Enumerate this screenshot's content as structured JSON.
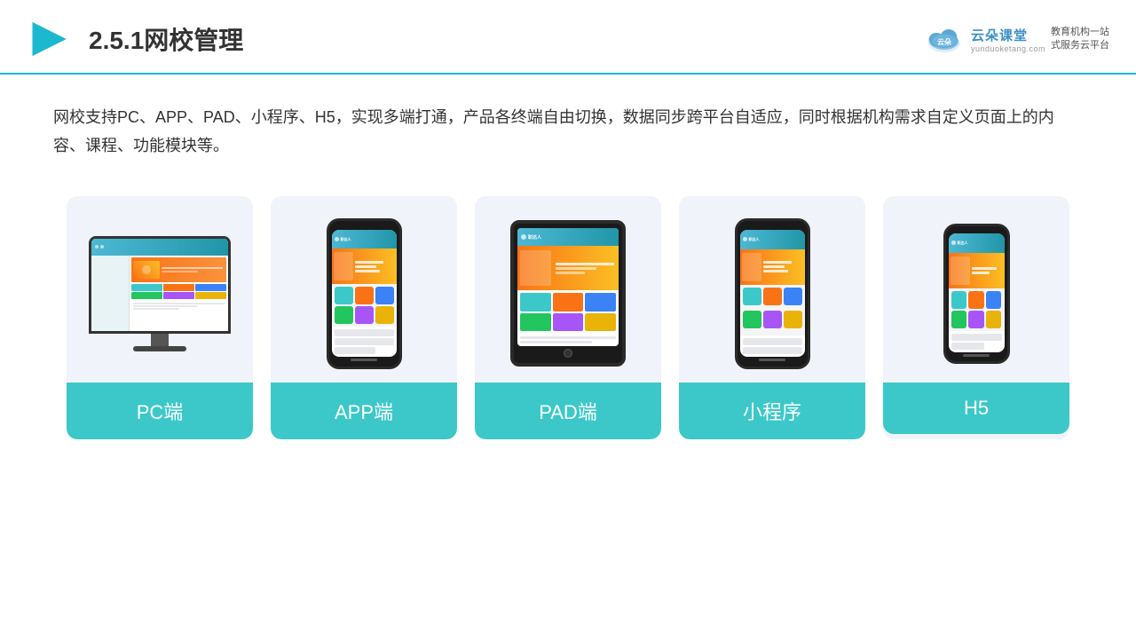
{
  "header": {
    "title": "2.5.1网校管理",
    "brand": {
      "name": "云朵课堂",
      "url": "yunduoketang.com",
      "slogan": "教育机构一站\n式服务云平台"
    }
  },
  "description": {
    "text": "网校支持PC、APP、PAD、小程序、H5，实现多端打通，产品各终端自由切换，数据同步跨平台自适应，同时根据机构需求自定义页面上的内容、课程、功能模块等。"
  },
  "cards": [
    {
      "id": "pc",
      "label": "PC端"
    },
    {
      "id": "app",
      "label": "APP端"
    },
    {
      "id": "pad",
      "label": "PAD端"
    },
    {
      "id": "miniprogram",
      "label": "小程序"
    },
    {
      "id": "h5",
      "label": "H5"
    }
  ]
}
